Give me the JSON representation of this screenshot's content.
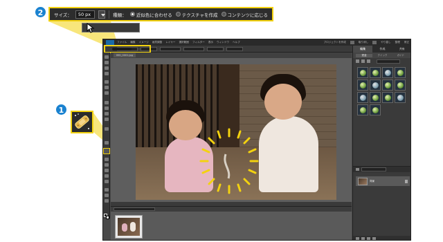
{
  "badges": {
    "one": "1",
    "two": "2"
  },
  "options_callout": {
    "size_label": "サイズ：",
    "size_value": "50 px",
    "type_label": "種類：",
    "radio_1": "近似色に合わせる",
    "radio_2": "テクスチャを作成",
    "radio_3": "コンテンツに応じる",
    "selected": "近似色に合わせる"
  },
  "menubar": {
    "items": [
      "ファイル",
      "編集",
      "イメージ",
      "画質調整",
      "レイヤー",
      "選択範囲",
      "フィルター",
      "表示",
      "ウィンドウ",
      "ヘルプ"
    ],
    "right": [
      "プロジェクトを作成",
      "取り消し",
      "やり直し",
      "整理",
      "修正"
    ]
  },
  "document": {
    "tab_1": "IMG_0001.jpg"
  },
  "panel": {
    "tabs": [
      "編集",
      "作成",
      "共有"
    ],
    "sub_tabs": [
      "完全",
      "クイック",
      "ガイド"
    ]
  },
  "layers": {
    "layer_name": "背景"
  },
  "colors": {
    "accent": "#f3d20f",
    "badge": "#1a82d0",
    "bg_dark": "#3a3a3a"
  },
  "icons": [
    "spot-healing-brush-icon",
    "cursor-arrow-icon",
    "sunburst-highlight-icon",
    "lock-icon"
  ]
}
